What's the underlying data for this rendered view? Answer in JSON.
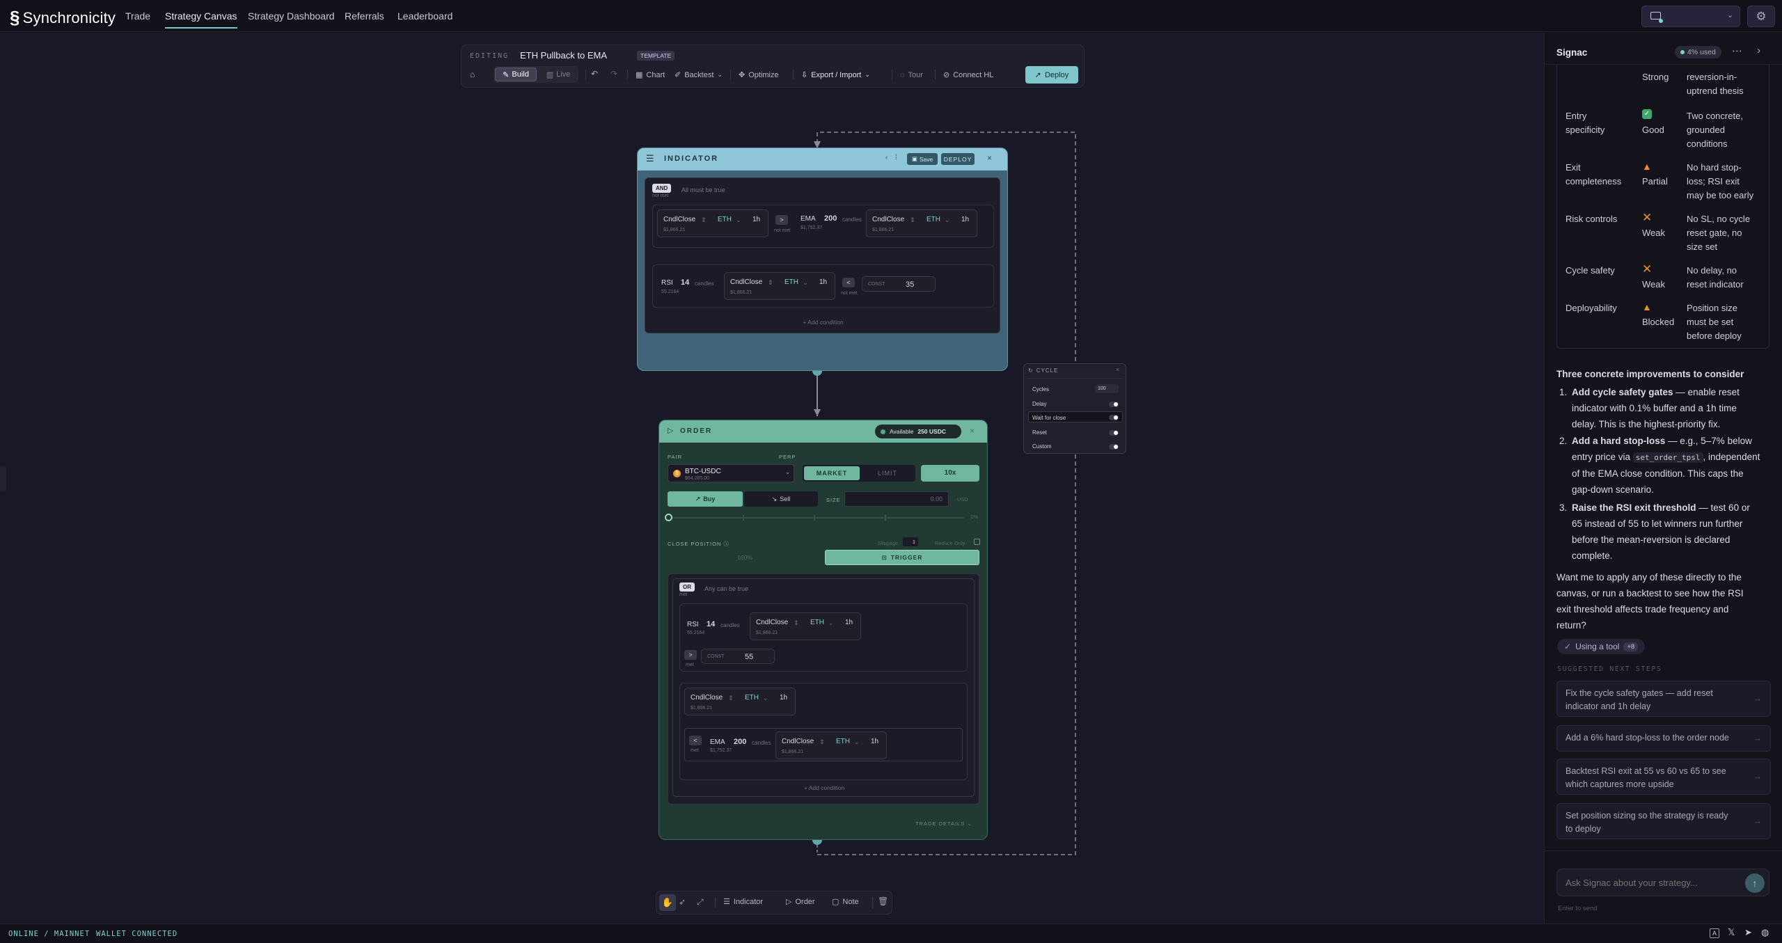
{
  "app": {
    "name": "Synchronicity"
  },
  "nav": [
    {
      "label": "Trade"
    },
    {
      "label": "Strategy Canvas"
    },
    {
      "label": "Strategy Dashboard"
    },
    {
      "label": "Referrals"
    },
    {
      "label": "Leaderboard"
    }
  ],
  "toolbar": {
    "editing_label": "EDITING",
    "strategy_name": "ETH Pullback to EMA",
    "template_badge": "TEMPLATE",
    "build": "Build",
    "live": "Live",
    "chart": "Chart",
    "backtest": "Backtest",
    "optimize": "Optimize",
    "export_import": "Export / Import",
    "tour": "Tour",
    "connect": "Connect HL",
    "deploy": "Deploy"
  },
  "indicator_node": {
    "title": "INDICATOR",
    "save": "Save",
    "deploy": "DEPLOY",
    "and_badge": "AND",
    "and_sub": "not met",
    "and_desc": "All must be true",
    "row1": {
      "left_label": "CndlClose",
      "asset": "ETH",
      "tf": "1h",
      "left_price": "$1,866.21",
      "op": ">",
      "op_sub": "not met",
      "ind": "EMA",
      "period": "200",
      "unit": "candles",
      "ind_value": "$1,752.37",
      "right_label": "CndlClose",
      "right_asset": "ETH",
      "right_tf": "1h",
      "right_price": "$1,866.21"
    },
    "row2": {
      "ind": "RSI",
      "period": "14",
      "unit": "candles",
      "ind_value": "55.2164",
      "src_label": "CndlClose",
      "asset": "ETH",
      "tf": "1h",
      "price": "$1,866.21",
      "op": "<",
      "op_sub": "not met",
      "const_label": "CONST",
      "const_value": "35"
    },
    "add_condition": "+ Add condition"
  },
  "cycle_node": {
    "title": "CYCLE",
    "rows": [
      {
        "label": "Cycles",
        "value": "100"
      },
      {
        "label": "Delay"
      },
      {
        "label": "Wait for close"
      },
      {
        "label": "Reset"
      },
      {
        "label": "Custom"
      }
    ]
  },
  "order_node": {
    "title": "ORDER",
    "available_label": "Available",
    "available_value": "250 USDC",
    "pair_label": "PAIR",
    "perp_label": "PERP",
    "pair": "BTC-USDC",
    "pair_price": "$64,285.00",
    "market": "MARKET",
    "limit": "LIMIT",
    "leverage": "10x",
    "buy": "Buy",
    "sell": "Sell",
    "size_label": "SIZE",
    "size_value": "0.00",
    "size_unit": "USD",
    "slider_end": "0%",
    "close_position": "CLOSE POSITION",
    "slippage_label": "Slippage",
    "slippage_value": "1",
    "reduce_only": "Reduce Only",
    "pct": "100%",
    "trigger": "TRIGGER",
    "or_badge": "OR",
    "or_sub": "met",
    "or_desc": "Any can be true",
    "or_row1": {
      "ind": "RSI",
      "period": "14",
      "unit": "candles",
      "ind_value": "55.2164",
      "src_label": "CndlClose",
      "asset": "ETH",
      "tf": "1h",
      "price": "$1,866.21",
      "op": ">",
      "op_sub": "met",
      "const_label": "CONST",
      "const_value": "55"
    },
    "or_row2": {
      "left_label": "CndlClose",
      "asset": "ETH",
      "tf": "1h",
      "left_price": "$1,866.21",
      "op": "<",
      "op_sub": "met",
      "ind": "EMA",
      "period": "200",
      "unit": "candles",
      "ind_value": "$1,752.37",
      "right_label": "CndlClose",
      "right_asset": "ETH",
      "right_tf": "1h",
      "right_price": "$1,866.21"
    },
    "add_condition": "+ Add condition",
    "trade_details": "TRADE DETAILS"
  },
  "bottom_tools": {
    "indicator": "Indicator",
    "order": "Order",
    "note": "Note"
  },
  "panel": {
    "title": "Signac",
    "usage": "4% used",
    "partial_row_rating": "Strong",
    "partial_row_note": [
      "reversion-in-",
      "uptrend thesis"
    ],
    "eval": [
      {
        "label": [
          "Entry",
          "specificity"
        ],
        "icon": "check-icon",
        "rating": "Good",
        "note": [
          "Two concrete,",
          "grounded",
          "conditions"
        ]
      },
      {
        "label": [
          "Exit",
          "completeness"
        ],
        "icon": "warning-icon",
        "rating": "Partial",
        "note": [
          "No hard stop-",
          "loss; RSI exit",
          "may be too early"
        ]
      },
      {
        "label": [
          "Risk controls"
        ],
        "icon": "cross-icon",
        "rating": "Weak",
        "note": [
          "No SL, no cycle",
          "reset gate, no",
          "size set"
        ]
      },
      {
        "label": [
          "Cycle safety"
        ],
        "icon": "cross-icon",
        "rating": "Weak",
        "note": [
          "No delay, no",
          "reset indicator"
        ]
      },
      {
        "label": [
          "Deployability"
        ],
        "icon": "warning-icon",
        "rating": "Blocked",
        "note": [
          "Position size",
          "must be set",
          "before deploy"
        ]
      }
    ],
    "improvements_title": "Three concrete improvements to consider",
    "imp1_bold": "Add cycle safety gates",
    "imp1_rest": [
      " — enable reset",
      "indicator with 0.1% buffer and a 1h time",
      "delay. This is the highest-priority fix."
    ],
    "imp2_bold": "Add a hard stop-loss",
    "imp2_line1": " — e.g., 5–7% below",
    "imp2_line2a": "entry price via ",
    "imp2_code": "set_order_tpsl",
    "imp2_line2b": ", independent",
    "imp2_rest": [
      "of the EMA close condition. This caps the",
      "gap-down scenario."
    ],
    "imp3_bold": "Raise the RSI exit threshold",
    "imp3_rest": [
      " — test 60 or",
      "65 instead of 55 to let winners run further",
      "before the mean-reversion is declared",
      "complete."
    ],
    "closing": [
      "Want me to apply any of these directly to the",
      "canvas, or run a backtest to see how the RSI",
      "exit threshold affects trade frequency and",
      "return?"
    ],
    "tool_pill": "Using a tool",
    "tool_count": "+8",
    "suggested_label": "SUGGESTED NEXT STEPS",
    "suggestions": [
      [
        "Fix the cycle safety gates — add reset",
        "indicator and 1h delay"
      ],
      [
        "Add a 6% hard stop-loss to the order node"
      ],
      [
        "Backtest RSI exit at 55 vs 60 vs 65 to see",
        "which captures more upside"
      ],
      [
        "Set position sizing so the strategy is ready",
        "to deploy"
      ]
    ],
    "input_placeholder": "Ask Signac about your strategy...",
    "input_hint": "Enter to send"
  },
  "status": {
    "network": "ONLINE / MAINNET",
    "wallet": "WALLET CONNECTED"
  },
  "colors": {
    "accent": "#7fc6cc",
    "indicator_header": "#8fc6d8",
    "order_header": "#6fb7a0",
    "deploy": "#7fc6cc"
  }
}
